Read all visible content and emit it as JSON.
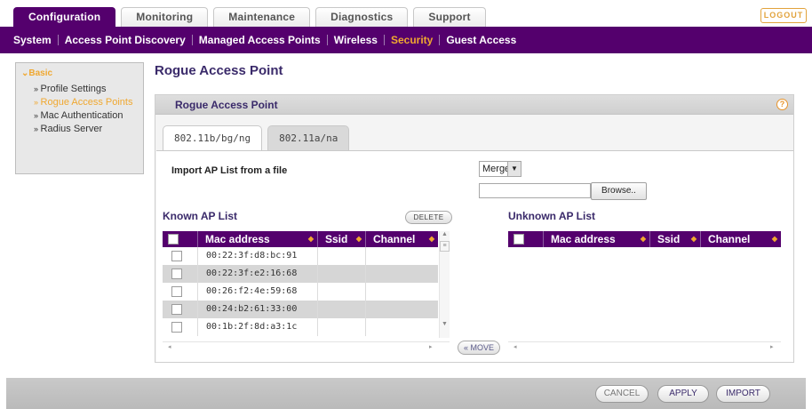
{
  "top_tabs": [
    {
      "label": "Configuration",
      "active": true
    },
    {
      "label": "Monitoring",
      "active": false
    },
    {
      "label": "Maintenance",
      "active": false
    },
    {
      "label": "Diagnostics",
      "active": false
    },
    {
      "label": "Support",
      "active": false
    }
  ],
  "logout_label": "LOGOUT",
  "subnav": [
    {
      "label": "System",
      "active": false
    },
    {
      "label": "Access Point Discovery",
      "active": false
    },
    {
      "label": "Managed Access Points",
      "active": false
    },
    {
      "label": "Wireless",
      "active": false
    },
    {
      "label": "Security",
      "active": true
    },
    {
      "label": "Guest Access",
      "active": false
    }
  ],
  "sidebar": {
    "heading": "Basic",
    "items": [
      {
        "label": "Profile Settings",
        "active": false
      },
      {
        "label": "Rogue Access Points",
        "active": true
      },
      {
        "label": "Mac Authentication",
        "active": false
      },
      {
        "label": "Radius Server",
        "active": false
      }
    ]
  },
  "page_title": "Rogue Access Point",
  "panel": {
    "title": "Rogue Access Point",
    "help_icon": "?",
    "radio_tabs": [
      {
        "label": "802.11b/bg/ng",
        "active": true
      },
      {
        "label": "802.11a/na",
        "active": false
      }
    ],
    "import_label": "Import AP List from a file",
    "import_mode": "Merge",
    "file_value": "",
    "browse_label": "Browse..",
    "delete_label": "DELETE",
    "move_label": "MOVE",
    "known": {
      "title": "Known AP List",
      "columns": [
        "Mac address",
        "Ssid",
        "Channel"
      ],
      "rows": [
        {
          "mac": "00:22:3f:d8:bc:91",
          "ssid": "",
          "channel": ""
        },
        {
          "mac": "00:22:3f:e2:16:68",
          "ssid": "",
          "channel": ""
        },
        {
          "mac": "00:26:f2:4e:59:68",
          "ssid": "",
          "channel": ""
        },
        {
          "mac": "00:24:b2:61:33:00",
          "ssid": "",
          "channel": ""
        },
        {
          "mac": "00:1b:2f:8d:a3:1c",
          "ssid": "",
          "channel": ""
        }
      ]
    },
    "unknown": {
      "title": "Unknown AP List",
      "columns": [
        "Mac address",
        "Ssid",
        "Channel"
      ],
      "rows": []
    }
  },
  "footer": {
    "cancel_label": "CANCEL",
    "apply_label": "APPLY",
    "import_label": "IMPORT"
  },
  "colors": {
    "brand_purple": "#54006d",
    "accent_orange": "#f0a830"
  }
}
